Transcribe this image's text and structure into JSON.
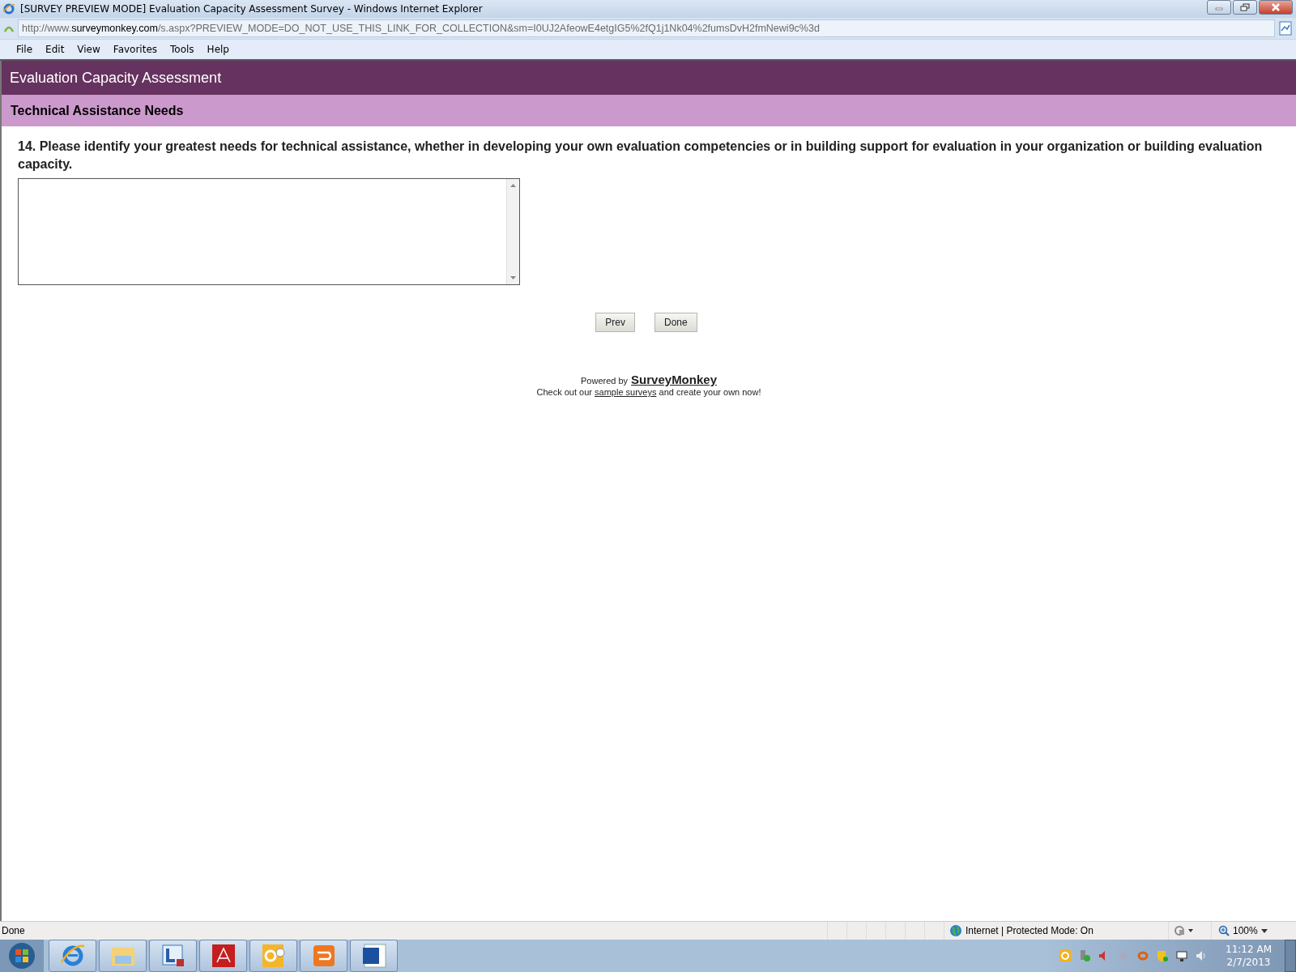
{
  "window": {
    "title": "[SURVEY PREVIEW MODE] Evaluation Capacity Assessment Survey - Windows Internet Explorer"
  },
  "address_bar": {
    "prefix": "http://www.",
    "domain": "surveymonkey.com",
    "path": "/s.aspx?PREVIEW_MODE=DO_NOT_USE_THIS_LINK_FOR_COLLECTION&sm=I0UJ2AfeowE4etgIG5%2fQ1j1Nk04%2fumsDvH2fmNewi9c%3d"
  },
  "menu": [
    "File",
    "Edit",
    "View",
    "Favorites",
    "Tools",
    "Help"
  ],
  "survey": {
    "title": "Evaluation Capacity Assessment",
    "page_title": "Technical Assistance Needs",
    "question": "14. Please identify your greatest needs for technical assistance, whether in developing your own evaluation competencies or in building support for evaluation in your organization or building evaluation capacity.",
    "buttons": [
      "Prev",
      "Done"
    ],
    "footer": {
      "powered_by": "Powered by",
      "brand": "SurveyMonkey",
      "line_before": "Check out our",
      "link": "sample surveys",
      "line_after": "and create your own now!"
    }
  },
  "status_bar": {
    "status": "Done",
    "zone": "Internet | Protected Mode: On",
    "zoom": "100%"
  },
  "taskbar": {
    "apps": [
      {
        "kind": "browser"
      },
      {
        "kind": "folder"
      },
      {
        "kind": "meeting"
      },
      {
        "kind": "pdf"
      },
      {
        "kind": "mail"
      },
      {
        "kind": "loop"
      },
      {
        "kind": "word"
      }
    ],
    "time": "11:12 AM",
    "date": "2/7/2013"
  }
}
